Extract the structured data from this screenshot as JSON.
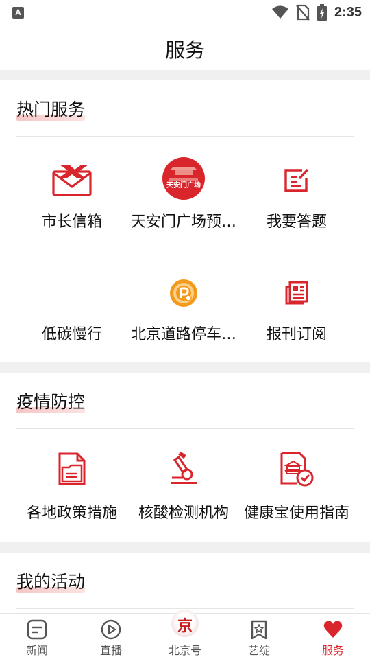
{
  "status_bar": {
    "time": "2:35",
    "left_icon": "A"
  },
  "header": {
    "title": "服务"
  },
  "sections": [
    {
      "title": "热门服务",
      "items": [
        {
          "label": "市长信箱",
          "icon": "mail-icon"
        },
        {
          "label": "天安门广场预…",
          "icon": "tiananmen-icon",
          "icon_text": "天安门广场"
        },
        {
          "label": "我要答题",
          "icon": "answer-icon"
        },
        {
          "label": "低碳慢行",
          "icon": "blank-icon"
        },
        {
          "label": "北京道路停车…",
          "icon": "parking-icon"
        },
        {
          "label": "报刊订阅",
          "icon": "newspaper-icon"
        }
      ]
    },
    {
      "title": "疫情防控",
      "items": [
        {
          "label": "各地政策措施",
          "icon": "document-icon"
        },
        {
          "label": "核酸检测机构",
          "icon": "microscope-icon"
        },
        {
          "label": "健康宝使用指南",
          "icon": "health-guide-icon"
        }
      ]
    },
    {
      "title": "我的活动",
      "items": []
    }
  ],
  "tabs": [
    {
      "label": "新闻",
      "icon": "news-icon",
      "active": false
    },
    {
      "label": "直播",
      "icon": "live-icon",
      "active": false
    },
    {
      "label": "北京号",
      "icon": "beijing-logo-icon",
      "active": false,
      "icon_text": "京"
    },
    {
      "label": "艺绽",
      "icon": "star-bookmark-icon",
      "active": false
    },
    {
      "label": "服务",
      "icon": "heart-icon",
      "active": true
    }
  ],
  "colors": {
    "accent": "#d9252c",
    "orange": "#f39a1b",
    "background": "#f0f0f0"
  }
}
